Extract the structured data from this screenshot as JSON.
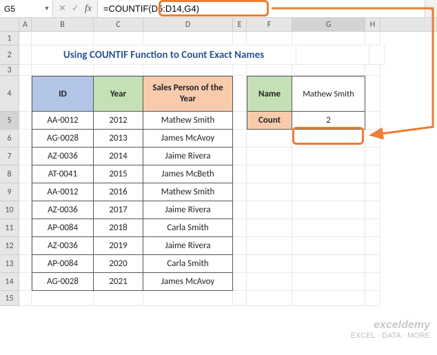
{
  "cellRef": "G5",
  "formula": "=COUNTIF(D5:D14,G4)",
  "title": "Using COUNTIF Function to Count Exact Names",
  "columns": [
    "A",
    "B",
    "C",
    "D",
    "E",
    "F",
    "G",
    "H"
  ],
  "rowNums": [
    "1",
    "2",
    "3",
    "4",
    "5",
    "6",
    "7",
    "8",
    "9",
    "10",
    "11",
    "12",
    "13",
    "14",
    "15"
  ],
  "headers": {
    "id": "ID",
    "year": "Year",
    "sp": "Sales Person of the Year"
  },
  "side": {
    "nameLabel": "Name",
    "nameValue": "Mathew Smith",
    "countLabel": "Count",
    "countValue": "2"
  },
  "table": [
    {
      "id": "AA-0012",
      "year": "2012",
      "sp": "Mathew Smith"
    },
    {
      "id": "AG-0028",
      "year": "2013",
      "sp": "James McAvoy"
    },
    {
      "id": "AZ-0036",
      "year": "2014",
      "sp": "Jaime Rivera"
    },
    {
      "id": "AT-0041",
      "year": "2015",
      "sp": "James McBeth"
    },
    {
      "id": "AA-0012",
      "year": "2016",
      "sp": "Mathew Smith"
    },
    {
      "id": "AZ-0036",
      "year": "2017",
      "sp": "Jaime Rivera"
    },
    {
      "id": "AP-0084",
      "year": "2018",
      "sp": "Carla Smith"
    },
    {
      "id": "AZ-0036",
      "year": "2019",
      "sp": "Jaime Rivera"
    },
    {
      "id": "AP-0084",
      "year": "2020",
      "sp": "Carla Smith"
    },
    {
      "id": "AG-0028",
      "year": "2021",
      "sp": "James McAvoy"
    }
  ],
  "watermark": {
    "brand": "exceldemy",
    "tag": "EXCEL · DATA · MORE"
  },
  "icons": {
    "dropdown": "▼",
    "cancel": "✕",
    "confirm": "✓",
    "fx": "fx",
    "expand": "⌄"
  }
}
